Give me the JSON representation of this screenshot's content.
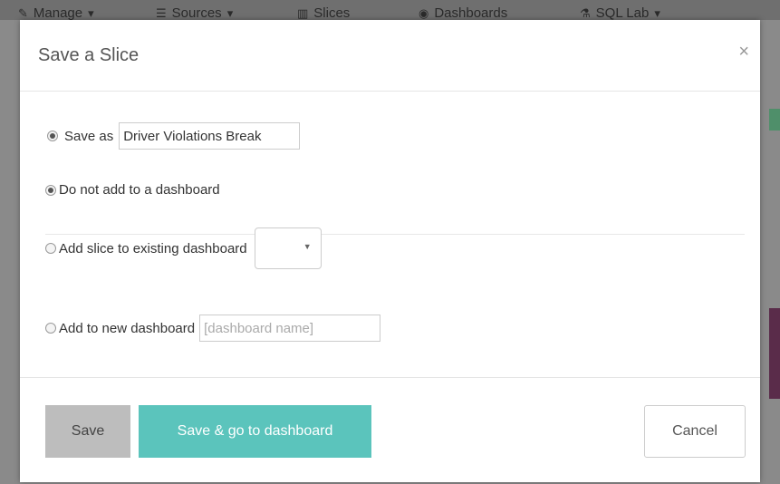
{
  "navbar": {
    "items": [
      {
        "icon": "wrench-icon",
        "label": "Manage"
      },
      {
        "icon": "database-icon",
        "label": "Sources"
      },
      {
        "icon": "bar-chart-icon",
        "label": "Slices"
      },
      {
        "icon": "dashboard-icon",
        "label": "Dashboards"
      },
      {
        "icon": "flask-icon",
        "label": "SQL Lab"
      }
    ]
  },
  "modal": {
    "title": "Save a Slice",
    "close_glyph": "×",
    "save_as": {
      "label": "Save as",
      "value": "Driver Violations Break",
      "checked": true
    },
    "dashboard_options": [
      {
        "label": "Do not add to a dashboard",
        "checked": true
      },
      {
        "label": "Add slice to existing dashboard",
        "checked": false
      },
      {
        "label": "Add to new dashboard",
        "checked": false
      }
    ],
    "existing_dashboard_select": {
      "value": "",
      "caret": "▼"
    },
    "new_dashboard_input": {
      "placeholder": "[dashboard name]",
      "value": ""
    },
    "footer": {
      "save_label": "Save",
      "save_go_label": "Save & go to dashboard",
      "cancel_label": "Cancel"
    }
  },
  "colors": {
    "accent": "#5bc4bc",
    "save_button": "#bdbdbd"
  }
}
